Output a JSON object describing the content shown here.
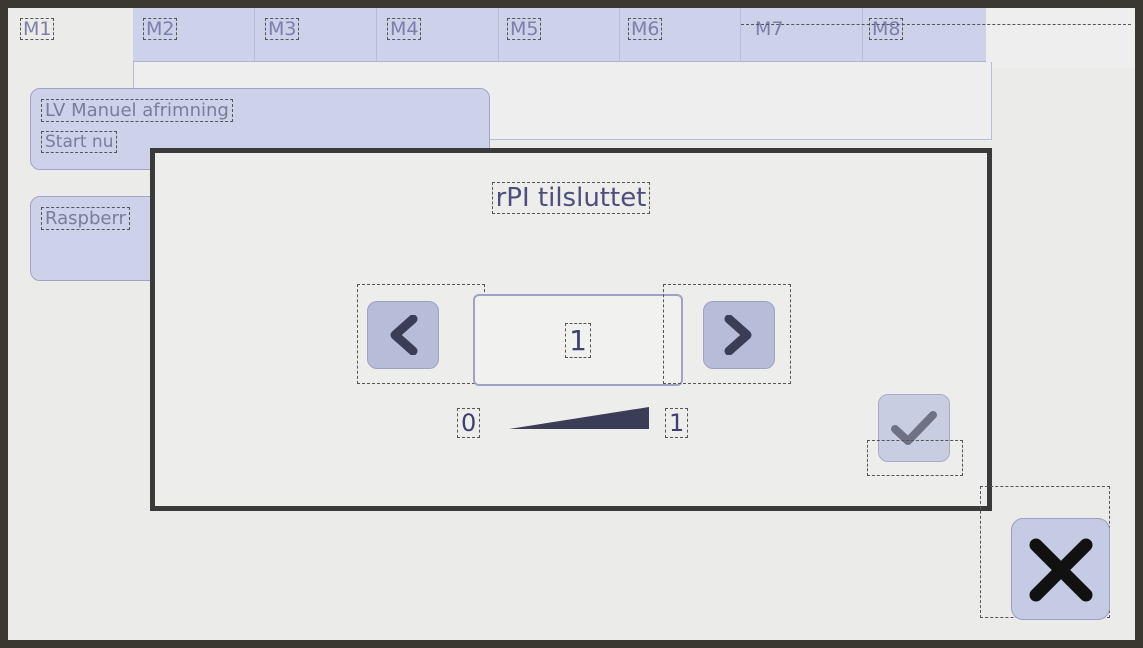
{
  "tabs": [
    {
      "label": "M1",
      "active": true
    },
    {
      "label": "M2",
      "active": false
    },
    {
      "label": "M3",
      "active": false
    },
    {
      "label": "M4",
      "active": false
    },
    {
      "label": "M5",
      "active": false
    },
    {
      "label": "M6",
      "active": false
    },
    {
      "label": "M7",
      "active": false
    },
    {
      "label": "M8",
      "active": false
    }
  ],
  "list": {
    "item1": {
      "title": "LV Manuel afrimning",
      "sub": "Start nu"
    },
    "item2": {
      "title": "Raspberr"
    }
  },
  "dialog": {
    "title": "rPI tilsluttet",
    "value": "1",
    "min": "0",
    "max": "1",
    "value_fraction": 1.0,
    "prev_icon": "chevron-left-icon",
    "next_icon": "chevron-right-icon",
    "ok_icon": "checkmark-icon"
  },
  "close_icon": "close-x-icon",
  "colors": {
    "tab_fill": "#cdd1ea",
    "button_fill": "#b7bcd9",
    "text": "#3c3f70",
    "dialog_border": "#3a3a3a"
  }
}
